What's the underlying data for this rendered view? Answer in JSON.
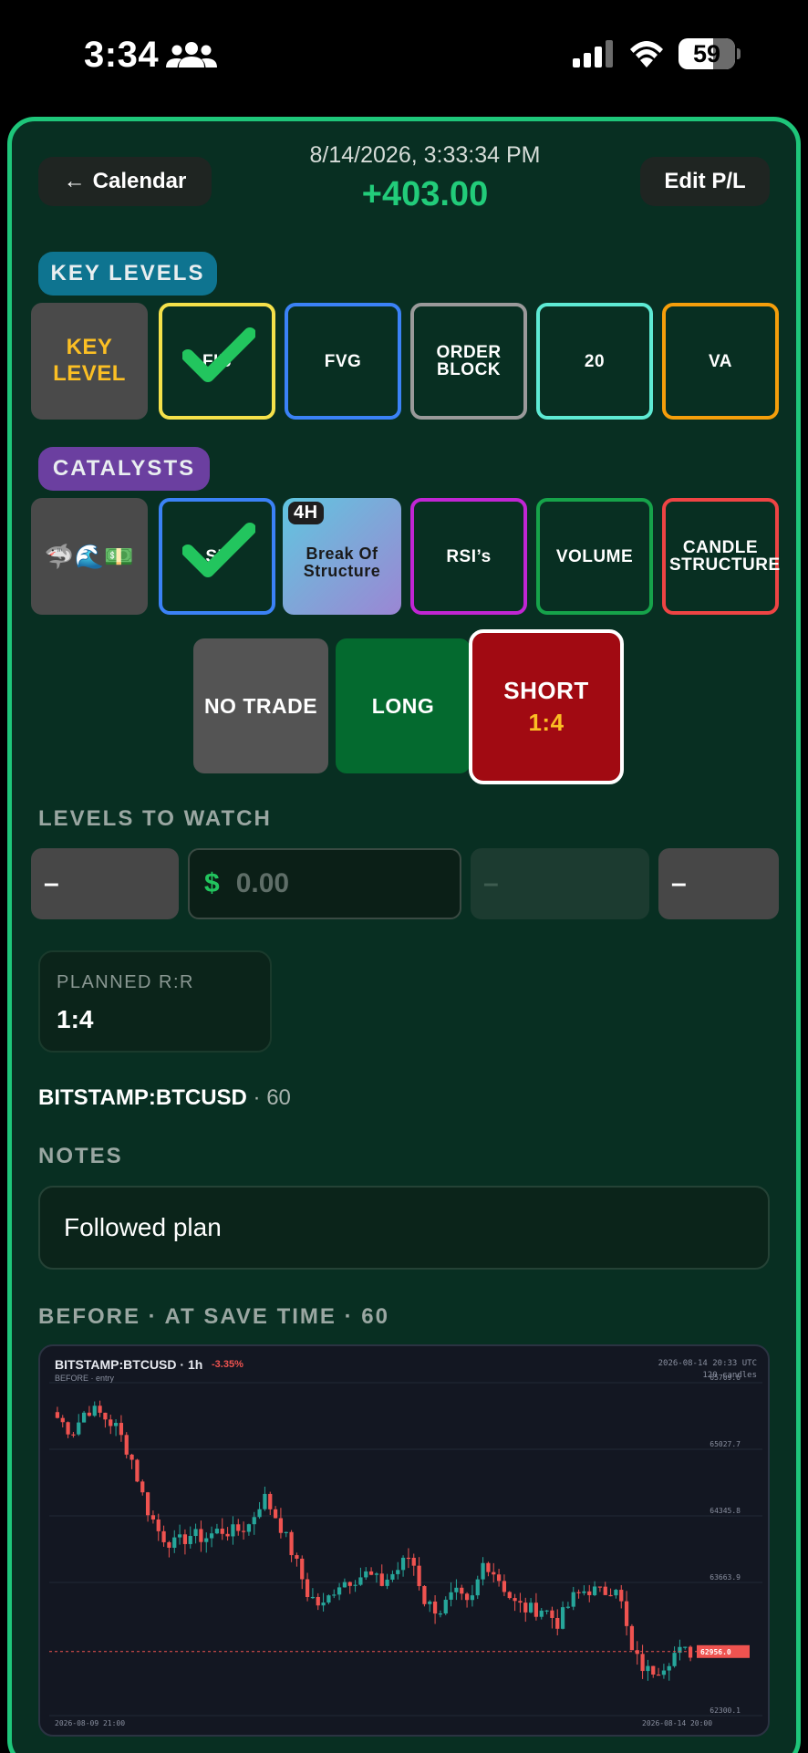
{
  "status_bar": {
    "time": "3:34",
    "battery": "59"
  },
  "header": {
    "back_label": "Calendar",
    "date": "8/14/2026, 3:33:34 PM",
    "pnl": "+403.00",
    "edit_label": "Edit P/L"
  },
  "key_levels": {
    "title": "KEY LEVELS",
    "row_label": [
      "KEY",
      "LEVEL"
    ],
    "items": [
      {
        "label": "FIB",
        "checked": true,
        "color": "#f5e14a"
      },
      {
        "label": "FVG",
        "checked": false,
        "color": "#3b82f6"
      },
      {
        "label": "ORDER BLOCK",
        "checked": false,
        "color": "#9a9a9a"
      },
      {
        "label": "20",
        "checked": false,
        "color": "#5eead4"
      },
      {
        "label": "VA",
        "checked": false,
        "color": "#f59e0b"
      }
    ]
  },
  "catalysts": {
    "title": "CATALYSTS",
    "row_emoji": "🦈🌊💵",
    "items": [
      {
        "label": "SF",
        "checked": true,
        "color": "#3b82f6"
      },
      {
        "label": "Break Of Structure",
        "badge": "4H",
        "checked": false
      },
      {
        "label": "RSI’s",
        "checked": false,
        "color": "#c026d3"
      },
      {
        "label": "VOLUME",
        "checked": false,
        "color": "#16a34a"
      },
      {
        "label": "CANDLE STRUCTURE",
        "checked": false,
        "color": "#ef4444"
      }
    ]
  },
  "trade": {
    "no_trade": "NO TRADE",
    "long": "LONG",
    "short": "SHORT",
    "short_ratio": "1:4",
    "selected": "short"
  },
  "levels_to_watch": {
    "title": "LEVELS TO WATCH",
    "dash1": "–",
    "currency": "$",
    "placeholder": "0.00",
    "dash2": "–",
    "dash3": "–"
  },
  "planned_rr": {
    "label": "PLANNED R:R",
    "value": "1:4"
  },
  "symbol": {
    "name": "BITSTAMP:BTCUSD",
    "timeframe": "· 60"
  },
  "notes": {
    "title": "NOTES",
    "text": "Followed plan"
  },
  "before_chart": {
    "section_title": "BEFORE · AT SAVE TIME · 60",
    "title": "BITSTAMP:BTCUSD · 1h",
    "change": "-3.35%",
    "sub": "BEFORE · entry",
    "timestamp": "2026-08-14 20:33 UTC",
    "candle_count": "120 candles",
    "x_start": "2026-08-09 21:00",
    "x_end": "2026-08-14 20:00",
    "price_tag": "62956.0",
    "colors": {
      "up": "#26a69a",
      "down": "#ef5350"
    }
  },
  "chart_data": {
    "type": "candlestick",
    "title": "BITSTAMP:BTCUSD · 1h",
    "y_ticks": [
      65709.6,
      65027.7,
      64345.8,
      63663.9,
      62300.1
    ],
    "ylim": [
      62300.1,
      65709.6
    ],
    "last_price": 62956.0,
    "x_range": [
      "2026-08-09 21:00",
      "2026-08-14 20:00"
    ],
    "close_path": [
      65350,
      65200,
      65450,
      65380,
      65250,
      64950,
      64450,
      64150,
      64050,
      64150,
      64120,
      64200,
      64180,
      64250,
      64550,
      64300,
      63950,
      63550,
      63400,
      63650,
      63700,
      63750,
      63650,
      63780,
      63950,
      63450,
      63380,
      63550,
      63400,
      63900,
      63700,
      63450,
      63380,
      63400,
      63250,
      63500,
      63600,
      63550,
      63650,
      62950,
      62750,
      62800,
      62950,
      62950
    ]
  }
}
